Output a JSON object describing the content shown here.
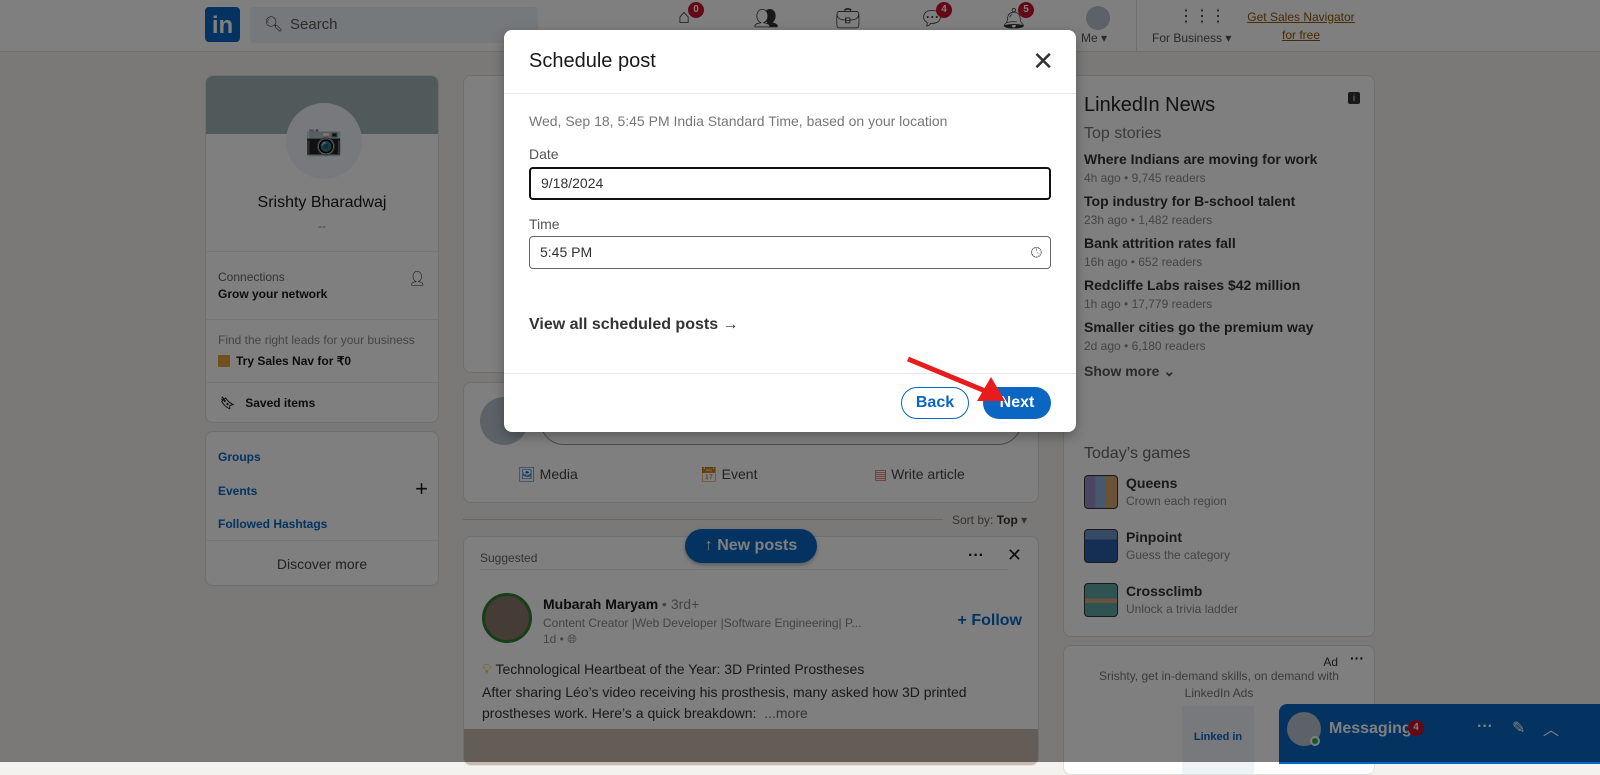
{
  "nav": {
    "logo": "in",
    "search_placeholder": "Search",
    "home_badge": "0",
    "messaging_badge": "4",
    "notifications_badge": "5",
    "me": "Me ▾",
    "for_business": "For Business ▾",
    "sales_nav": "Get Sales Navigator for free"
  },
  "profile": {
    "name": "Srishty Bharadwaj",
    "headline": "--",
    "connections_label": "Connections",
    "connections_sub": "Grow your network",
    "leads_text": "Find the right leads for your business",
    "sales_nav_try": "Try Sales Nav for ₹0",
    "saved_items": "Saved items"
  },
  "community": {
    "groups": "Groups",
    "events": "Events",
    "hashtags": "Followed Hashtags",
    "discover": "Discover more"
  },
  "composer": {
    "media": "Media",
    "event": "Event",
    "article": "Write article"
  },
  "feed": {
    "sort_label": "Sort by:",
    "sort_value": "Top",
    "new_posts": "↑ New posts",
    "suggested": "Suggested",
    "author": "Mubarah Maryam",
    "degree": "• 3rd+",
    "author_headline": "Content Creator |Web Developer |Software Engineering| P...",
    "time": "1d •",
    "follow": "+ Follow",
    "post_title": "Technological Heartbeat of the Year: 3D Printed Prostheses",
    "post_body": "After sharing Léo’s video receiving his prosthesis, many asked how 3D printed prostheses work. Here’s a quick breakdown:",
    "more": "...more"
  },
  "news": {
    "title": "LinkedIn News",
    "subtitle": "Top stories",
    "items": [
      {
        "title": "Where Indians are moving for work",
        "meta": "4h ago • 9,745 readers"
      },
      {
        "title": "Top industry for B-school talent",
        "meta": "23h ago • 1,482 readers"
      },
      {
        "title": "Bank attrition rates fall",
        "meta": "16h ago • 652 readers"
      },
      {
        "title": "Redcliffe Labs raises $42 million",
        "meta": "1h ago • 17,779 readers"
      },
      {
        "title": "Smaller cities go the premium way",
        "meta": "2d ago • 6,180 readers"
      }
    ],
    "show_more": "Show more ⌄",
    "games_title": "Today’s games",
    "games": [
      {
        "title": "Queens",
        "sub": "Crown each region"
      },
      {
        "title": "Pinpoint",
        "sub": "Guess the category"
      },
      {
        "title": "Crossclimb",
        "sub": "Unlock a trivia ladder"
      }
    ]
  },
  "ad": {
    "label": "Ad",
    "text": "Srishty, get in-demand skills, on demand with LinkedIn Ads",
    "logo": "Linked in"
  },
  "messaging": {
    "label": "Messaging",
    "badge": "4"
  },
  "dialog": {
    "title": "Schedule post",
    "tz_note": "Wed, Sep 18, 5:45 PM India Standard Time, based on your location",
    "date_label": "Date",
    "date_value": "9/18/2024",
    "time_label": "Time",
    "time_value": "5:45 PM",
    "view_all": "View all scheduled posts →",
    "back": "Back",
    "next": "Next"
  },
  "colors": {
    "brand": "#0a66c2",
    "annotation_arrow": "#e81c1c"
  }
}
